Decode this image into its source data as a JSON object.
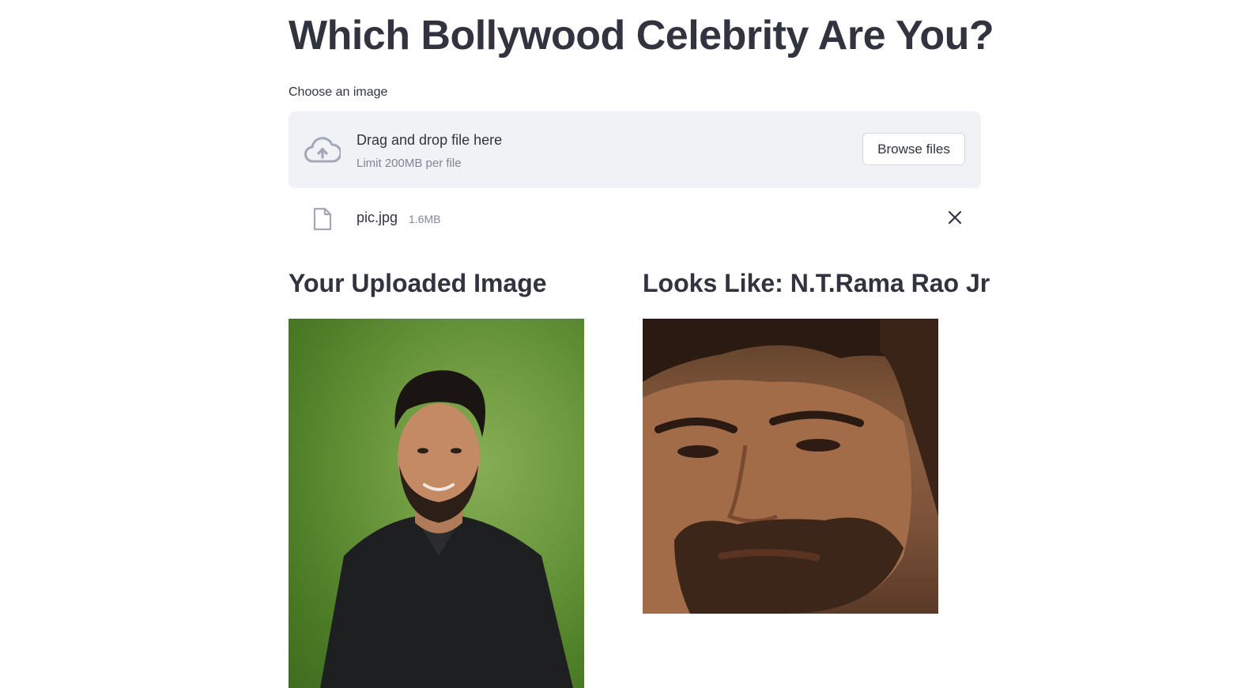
{
  "header": {
    "title": "Which Bollywood Celebrity Are You?"
  },
  "uploader": {
    "label": "Choose an image",
    "drop_text": "Drag and drop file here",
    "limit_text": "Limit 200MB per file",
    "browse_label": "Browse files",
    "icon": "cloud-upload-icon"
  },
  "uploaded_file": {
    "name": "pic.jpg",
    "size": "1.6MB",
    "icon": "file-icon",
    "remove_icon": "close-icon"
  },
  "results": {
    "left_heading": "Your Uploaded Image",
    "right_heading": "Looks Like: N.T.Rama Rao Jr"
  },
  "colors": {
    "accent_text": "#31333f",
    "dropzone_bg": "#f0f2f6",
    "muted_text": "#808495",
    "icon_color": "#a3a8b8"
  }
}
